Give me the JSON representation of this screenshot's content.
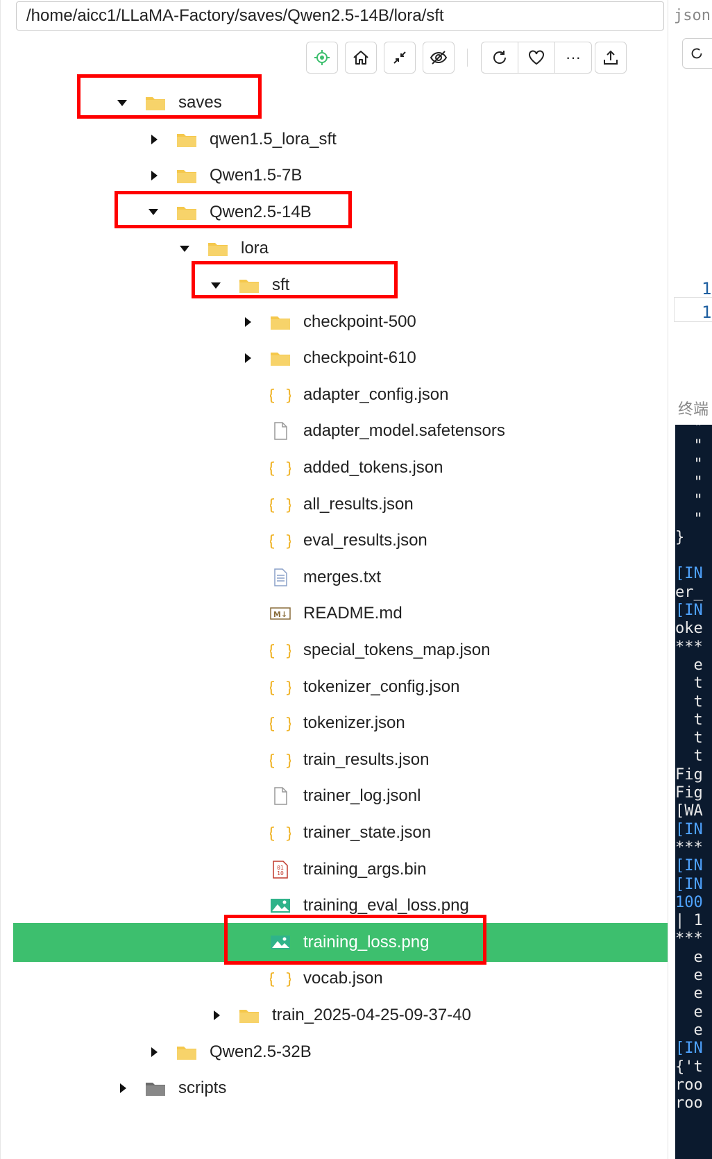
{
  "path": "/home/aicc1/LLaMA-Factory/saves/Qwen2.5-14B/lora/sft",
  "toolbar": {
    "buttons": [
      "locate-icon",
      "home-icon",
      "collapse-icon",
      "eye-off-icon",
      "refresh-icon",
      "heart-icon",
      "more-icon",
      "upload-icon"
    ],
    "more_label": "···"
  },
  "tree": [
    {
      "label": "saves",
      "type": "folder",
      "expanded": true,
      "depth": 0
    },
    {
      "label": "qwen1.5_lora_sft",
      "type": "folder",
      "expanded": false,
      "depth": 1
    },
    {
      "label": "Qwen1.5-7B",
      "type": "folder",
      "expanded": false,
      "depth": 1
    },
    {
      "label": "Qwen2.5-14B",
      "type": "folder",
      "expanded": true,
      "depth": 1
    },
    {
      "label": "lora",
      "type": "folder",
      "expanded": true,
      "depth": 2
    },
    {
      "label": "sft",
      "type": "folder",
      "expanded": true,
      "depth": 3
    },
    {
      "label": "checkpoint-500",
      "type": "folder",
      "expanded": false,
      "depth": 4
    },
    {
      "label": "checkpoint-610",
      "type": "folder",
      "expanded": false,
      "depth": 4
    },
    {
      "label": "adapter_config.json",
      "type": "json",
      "depth": 4
    },
    {
      "label": "adapter_model.safetensors",
      "type": "file",
      "depth": 4
    },
    {
      "label": "added_tokens.json",
      "type": "json",
      "depth": 4
    },
    {
      "label": "all_results.json",
      "type": "json",
      "depth": 4
    },
    {
      "label": "eval_results.json",
      "type": "json",
      "depth": 4
    },
    {
      "label": "merges.txt",
      "type": "text",
      "depth": 4
    },
    {
      "label": "README.md",
      "type": "markdown",
      "depth": 4
    },
    {
      "label": "special_tokens_map.json",
      "type": "json",
      "depth": 4
    },
    {
      "label": "tokenizer_config.json",
      "type": "json",
      "depth": 4
    },
    {
      "label": "tokenizer.json",
      "type": "json",
      "depth": 4
    },
    {
      "label": "train_results.json",
      "type": "json",
      "depth": 4
    },
    {
      "label": "trainer_log.jsonl",
      "type": "file",
      "depth": 4
    },
    {
      "label": "trainer_state.json",
      "type": "json",
      "depth": 4
    },
    {
      "label": "training_args.bin",
      "type": "binary",
      "depth": 4
    },
    {
      "label": "training_eval_loss.png",
      "type": "image",
      "depth": 4
    },
    {
      "label": "training_loss.png",
      "type": "image",
      "depth": 4,
      "selected": true
    },
    {
      "label": "vocab.json",
      "type": "json",
      "depth": 4
    },
    {
      "label": "train_2025-04-25-09-37-40",
      "type": "folder",
      "expanded": false,
      "depth": 3
    },
    {
      "label": "Qwen2.5-32B",
      "type": "folder",
      "expanded": false,
      "depth": 1
    },
    {
      "label": "scripts",
      "type": "folder-dark",
      "expanded": false,
      "depth": 0
    }
  ],
  "right_panel": {
    "tab_label": "json",
    "line_numbers": [
      "1",
      "1"
    ],
    "terminal_label": "终端",
    "terminal_lines": [
      {
        "text": "  \"",
        "color": "white"
      },
      {
        "text": "  \"",
        "color": "white"
      },
      {
        "text": "  \"",
        "color": "white"
      },
      {
        "text": "  \"",
        "color": "white"
      },
      {
        "text": "  \"",
        "color": "white"
      },
      {
        "text": "  \"",
        "color": "white"
      },
      {
        "text": "}",
        "color": "white"
      },
      {
        "text": "",
        "color": "white"
      },
      {
        "text": "[IN",
        "color": "blue"
      },
      {
        "text": "er_",
        "color": "white"
      },
      {
        "text": "[IN",
        "color": "blue"
      },
      {
        "text": "oke",
        "color": "white"
      },
      {
        "text": "***",
        "color": "white"
      },
      {
        "text": "  e",
        "color": "white"
      },
      {
        "text": "  t",
        "color": "white"
      },
      {
        "text": "  t",
        "color": "white"
      },
      {
        "text": "  t",
        "color": "white"
      },
      {
        "text": "  t",
        "color": "white"
      },
      {
        "text": "  t",
        "color": "white"
      },
      {
        "text": "Fig",
        "color": "white"
      },
      {
        "text": "Fig",
        "color": "white"
      },
      {
        "text": "[WA",
        "color": "white"
      },
      {
        "text": "[IN",
        "color": "blue"
      },
      {
        "text": "***",
        "color": "white"
      },
      {
        "text": "[IN",
        "color": "blue"
      },
      {
        "text": "[IN",
        "color": "blue"
      },
      {
        "text": "100",
        "color": "blue"
      },
      {
        "text": "| 1",
        "color": "white"
      },
      {
        "text": "***",
        "color": "white"
      },
      {
        "text": "  e",
        "color": "white"
      },
      {
        "text": "  e",
        "color": "white"
      },
      {
        "text": "  e",
        "color": "white"
      },
      {
        "text": "  e",
        "color": "white"
      },
      {
        "text": "  e",
        "color": "white"
      },
      {
        "text": "[IN",
        "color": "blue"
      },
      {
        "text": "{'t",
        "color": "white"
      },
      {
        "text": "roo",
        "color": "white"
      },
      {
        "text": "roo",
        "color": "white"
      }
    ]
  },
  "colors": {
    "selected_row": "#3dbf6e",
    "highlight_box": "#ff0000",
    "folder": "#f5c84c",
    "json_brace": "#f0b429"
  }
}
